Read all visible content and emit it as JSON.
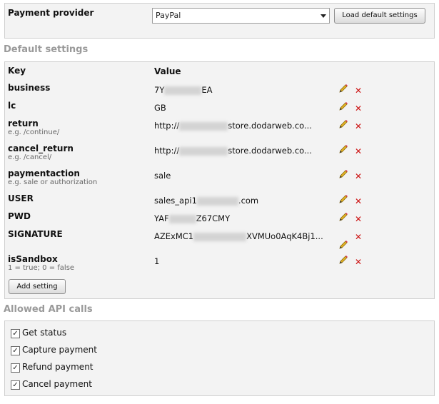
{
  "provider": {
    "label": "Payment provider",
    "selected": "PayPal",
    "load_button": "Load default settings"
  },
  "settings": {
    "title": "Default settings",
    "col_key": "Key",
    "col_value": "Value",
    "rows": [
      {
        "key": "business",
        "hint": "",
        "value_pre": "7Y",
        "value_post": "EA"
      },
      {
        "key": "lc",
        "hint": "",
        "value_pre": "GB",
        "value_post": ""
      },
      {
        "key": "return",
        "hint": "e.g. /continue/",
        "value_pre": "http://",
        "value_post": "store.dodarweb.co..."
      },
      {
        "key": "cancel_return",
        "hint": "e.g. /cancel/",
        "value_pre": "http://",
        "value_post": "store.dodarweb.co..."
      },
      {
        "key": "paymentaction",
        "hint": "e.g. sale or authorization",
        "value_pre": "sale",
        "value_post": ""
      },
      {
        "key": "USER",
        "hint": "",
        "value_pre": "sales_api1",
        "value_post": ".com"
      },
      {
        "key": "PWD",
        "hint": "",
        "value_pre": "YAF",
        "value_post": "Z67CMY"
      },
      {
        "key": "SIGNATURE",
        "hint": "",
        "value_pre": "AZExMC1",
        "value_post": "XVMUo0AqK4Bj1..."
      },
      {
        "key": "isSandbox",
        "hint": "1 = true; 0 = false",
        "value_pre": "1",
        "value_post": ""
      }
    ],
    "add_button": "Add setting"
  },
  "api": {
    "title": "Allowed API calls",
    "items": [
      {
        "label": "Get status",
        "checked": true
      },
      {
        "label": "Capture payment",
        "checked": true
      },
      {
        "label": "Refund payment",
        "checked": true
      },
      {
        "label": "Cancel payment",
        "checked": true
      }
    ]
  },
  "colors": {
    "delete": "#cc1111",
    "section_title": "#9a9a9a",
    "panel_bg": "#f3f3f3"
  }
}
